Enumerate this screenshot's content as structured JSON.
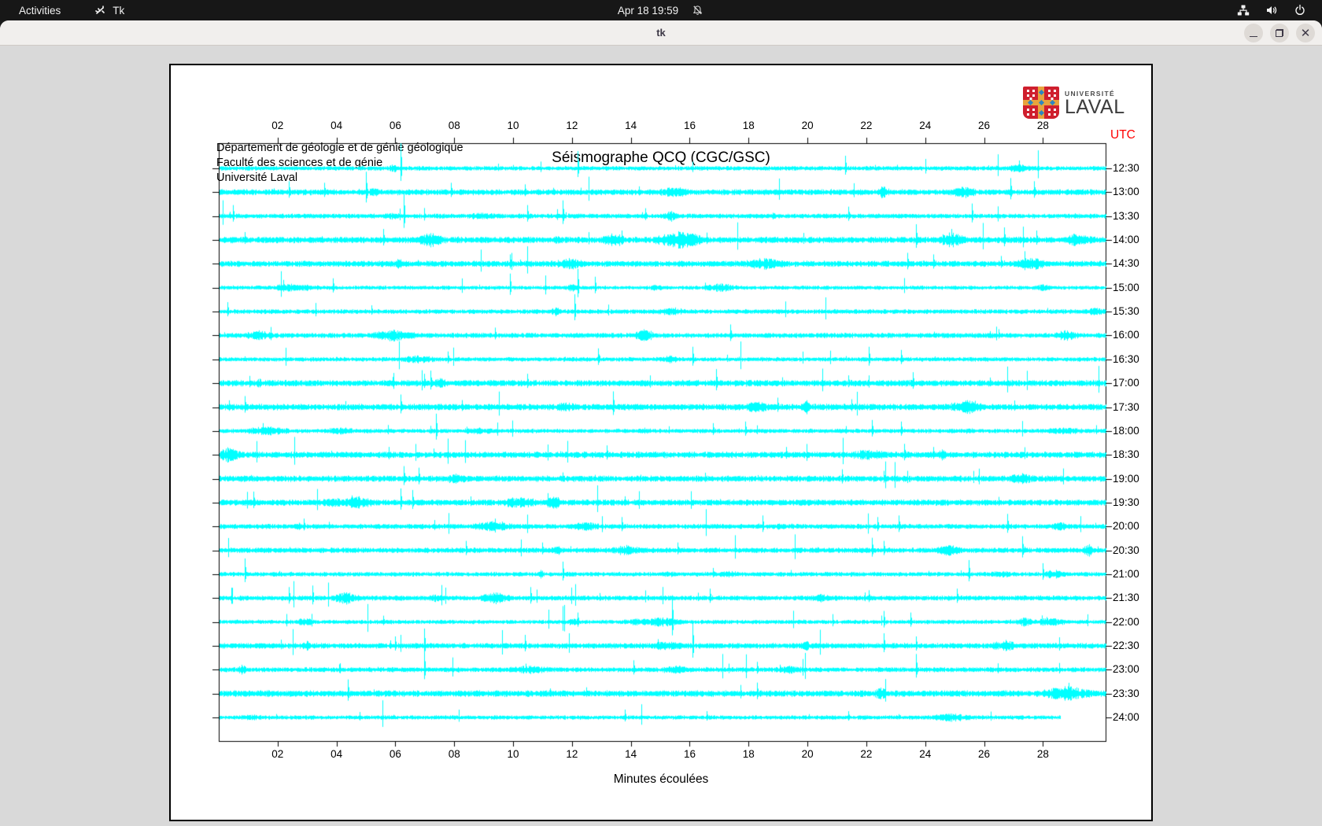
{
  "topbar": {
    "activities_label": "Activities",
    "app_name": "Tk",
    "clock": "Apr 18 19:59",
    "icons": [
      "tk-app-icon",
      "bell-slash-icon",
      "network-wired-icon",
      "volume-icon",
      "power-icon"
    ]
  },
  "titlebar": {
    "title": "tk",
    "buttons": [
      "minimize",
      "restore",
      "close"
    ]
  },
  "document": {
    "header_lines": {
      "0": "Département de géologie et de génie géologique",
      "1": "Faculté des sciences et de génie",
      "2": "Université Laval"
    },
    "logo": {
      "text_top": "UNIVERSITÉ",
      "text_bottom": "LAVAL"
    },
    "utc_label": "UTC",
    "utc_color": "#ff0000"
  },
  "chart_data": {
    "type": "line",
    "subtype": "helicorder-seismogram",
    "title": "Séismographe QCQ (CGC/GSC)",
    "xlabel": "Minutes écoulées",
    "ylabel_right": "UTC",
    "x_range_minutes": [
      0,
      30.13
    ],
    "x_tick_labels": [
      "02",
      "04",
      "06",
      "08",
      "10",
      "12",
      "14",
      "16",
      "18",
      "20",
      "22",
      "24",
      "26",
      "28"
    ],
    "x_tick_minutes": [
      2,
      4,
      6,
      8,
      10,
      12,
      14,
      16,
      18,
      20,
      22,
      24,
      26,
      28
    ],
    "grid": false,
    "trace_color": "#00ffff",
    "frame_color": "#000000",
    "last_trace_end_minute": 28.6,
    "noise": {
      "seed": 911,
      "base_amplitude": 1.5,
      "bursts_min": 2,
      "bursts_max": 6,
      "small_spikes_min": 7,
      "small_spikes_max": 18
    },
    "traces": [
      {
        "label": "12:30",
        "spikes": [
          [
            6.2,
            32
          ],
          [
            12.2,
            22
          ],
          [
            21.3,
            16
          ],
          [
            27.2,
            10
          ]
        ]
      },
      {
        "label": "13:00",
        "spikes": [
          [
            2.4,
            14
          ],
          [
            3.6,
            12
          ],
          [
            5.0,
            26
          ],
          [
            7.9,
            12
          ],
          [
            10.4,
            10
          ],
          [
            26.9,
            18
          ],
          [
            27.7,
            14
          ]
        ]
      },
      {
        "label": "13:30",
        "spikes": [
          [
            0.5,
            14
          ],
          [
            6.3,
            30
          ],
          [
            10.5,
            14
          ],
          [
            11.7,
            20
          ],
          [
            14.5,
            10
          ],
          [
            21.4,
            12
          ],
          [
            25.6,
            16
          ]
        ]
      },
      {
        "label": "14:00",
        "spikes": [
          [
            0.9,
            10
          ],
          [
            5.6,
            14
          ],
          [
            13.7,
            12
          ],
          [
            23.7,
            20
          ],
          [
            24.9,
            14
          ],
          [
            26.7,
            16
          ],
          [
            27.8,
            12
          ]
        ]
      },
      {
        "label": "14:30",
        "spikes": [
          [
            9.9,
            12
          ],
          [
            23.4,
            14
          ],
          [
            24.3,
            12
          ],
          [
            26.6,
            10
          ],
          [
            27.4,
            16
          ]
        ]
      },
      {
        "label": "15:00",
        "spikes": [
          [
            2.2,
            10
          ],
          [
            3.9,
            12
          ],
          [
            9.9,
            18
          ],
          [
            12.2,
            24
          ],
          [
            12.8,
            14
          ]
        ]
      },
      {
        "label": "15:30",
        "spikes": [
          [
            0.3,
            12
          ],
          [
            5.2,
            8
          ],
          [
            12.1,
            22
          ]
        ]
      },
      {
        "label": "16:00",
        "spikes": [
          [
            9.4,
            10
          ],
          [
            17.4,
            14
          ],
          [
            26.5,
            8
          ]
        ]
      },
      {
        "label": "16:30",
        "spikes": [
          [
            7.8,
            10
          ],
          [
            12.9,
            14
          ],
          [
            16.1,
            16
          ],
          [
            22.1,
            16
          ],
          [
            23.2,
            12
          ]
        ]
      },
      {
        "label": "17:00",
        "spikes": [
          [
            7.0,
            12
          ],
          [
            7.2,
            16
          ],
          [
            10.5,
            12
          ],
          [
            16.9,
            18
          ],
          [
            21.4,
            10
          ],
          [
            23.6,
            14
          ]
        ]
      },
      {
        "label": "17:30",
        "spikes": [
          [
            0.9,
            14
          ],
          [
            6.2,
            16
          ],
          [
            13.4,
            20
          ],
          [
            19.0,
            12
          ],
          [
            21.5,
            10
          ],
          [
            25.7,
            8
          ]
        ]
      },
      {
        "label": "18:00",
        "spikes": [
          [
            1.5,
            10
          ],
          [
            7.4,
            22
          ],
          [
            16.8,
            10
          ],
          [
            17.9,
            12
          ],
          [
            22.2,
            14
          ],
          [
            23.2,
            12
          ]
        ]
      },
      {
        "label": "18:30",
        "spikes": [
          [
            7.3,
            8
          ],
          [
            13.2,
            12
          ],
          [
            19.3,
            10
          ],
          [
            23.3,
            14
          ],
          [
            24.3,
            10
          ]
        ]
      },
      {
        "label": "19:00",
        "spikes": [
          [
            6.3,
            16
          ],
          [
            6.8,
            14
          ],
          [
            11.7,
            8
          ],
          [
            21.2,
            12
          ],
          [
            22.6,
            10
          ]
        ]
      },
      {
        "label": "19:30",
        "spikes": [
          [
            1.2,
            14
          ],
          [
            6.2,
            18
          ],
          [
            6.6,
            16
          ],
          [
            11.2,
            12
          ],
          [
            13.8,
            8
          ]
        ]
      },
      {
        "label": "20:00",
        "spikes": [
          [
            2.9,
            10
          ],
          [
            9.4,
            10
          ],
          [
            13.7,
            12
          ],
          [
            18.5,
            14
          ],
          [
            22.4,
            12
          ],
          [
            23.1,
            14
          ],
          [
            26.8,
            16
          ]
        ]
      },
      {
        "label": "20:30",
        "spikes": [
          [
            8.4,
            12
          ],
          [
            11.0,
            10
          ],
          [
            15.6,
            10
          ],
          [
            22.2,
            16
          ],
          [
            22.6,
            12
          ],
          [
            27.3,
            18
          ]
        ]
      },
      {
        "label": "21:00",
        "spikes": [
          [
            0.9,
            20
          ],
          [
            11.7,
            16
          ],
          [
            16.8,
            8
          ],
          [
            25.5,
            18
          ],
          [
            28.0,
            14
          ]
        ]
      },
      {
        "label": "21:30",
        "spikes": [
          [
            2.4,
            14
          ],
          [
            3.2,
            16
          ],
          [
            10.6,
            14
          ],
          [
            16.7,
            12
          ],
          [
            22.1,
            10
          ],
          [
            25.1,
            12
          ]
        ]
      },
      {
        "label": "22:00",
        "spikes": [
          [
            5.6,
            8
          ],
          [
            12.2,
            12
          ],
          [
            15.4,
            34
          ],
          [
            22.6,
            14
          ],
          [
            23.5,
            12
          ]
        ]
      },
      {
        "label": "22:30",
        "spikes": [
          [
            6.0,
            12
          ],
          [
            7.0,
            22
          ],
          [
            10.4,
            14
          ],
          [
            16.1,
            30
          ],
          [
            22.6,
            16
          ],
          [
            23.7,
            12
          ]
        ]
      },
      {
        "label": "23:00",
        "spikes": [
          [
            7.0,
            24
          ],
          [
            14.1,
            12
          ],
          [
            18.3,
            10
          ],
          [
            23.7,
            20
          ]
        ]
      },
      {
        "label": "23:30",
        "spikes": [
          [
            4.4,
            18
          ],
          [
            12.5,
            8
          ],
          [
            18.3,
            14
          ]
        ]
      },
      {
        "label": "24:00",
        "spikes": [
          [
            13.8,
            10
          ],
          [
            16.6,
            8
          ],
          [
            21.4,
            8
          ]
        ]
      }
    ]
  }
}
